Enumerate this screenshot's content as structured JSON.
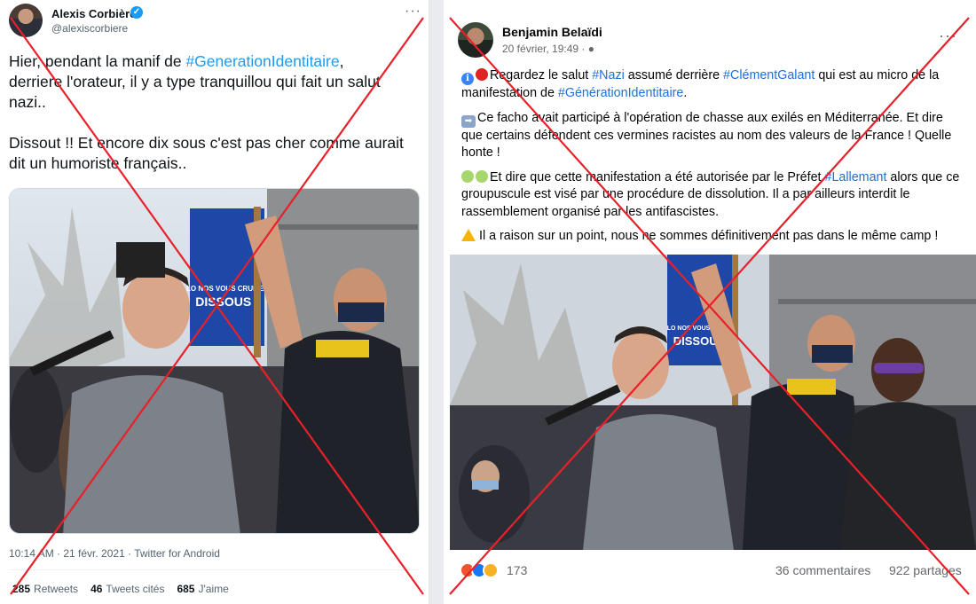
{
  "tweet": {
    "author_name": "Alexis Corbière",
    "handle": "@alexiscorbiere",
    "text_part1": "Hier, pendant la manif de ",
    "hashtag": "#GenerationIdentitaire",
    "text_part2": ",\nderriere l'orateur, il y a type tranquillou qui fait un salut nazi..\n\nDissout !! Et encore dix sous c'est pas cher comme aurait dit un humoriste français..",
    "timestamp": "10:14 AM · 21 févr. 2021 · ",
    "source": "Twitter for Android",
    "stats": {
      "retweets_count": "285",
      "retweets_label": "Retweets",
      "quotes_count": "46",
      "quotes_label": "Tweets cités",
      "likes_count": "685",
      "likes_label": "J'aime"
    },
    "photo_sign_text": "LO NOS VOUS CRUMEZ DISSOUS !"
  },
  "facebook": {
    "author_name": "Benjamin Belaïdi",
    "date": "20 février, 19:49 · ",
    "p1_a": "Regardez le salut ",
    "p1_tag1": "#Nazi",
    "p1_b": " assumé derrière ",
    "p1_tag2": "#ClémentGalant",
    "p1_c": " qui est au micro de la manifestation de ",
    "p1_tag3": "#GénérationIdentitaire",
    "p1_d": ".",
    "p2": "Ce facho avait participé à l'opération de chasse aux exilés en Méditerranée. Et dire que certains défendent ces vermines racistes au nom des valeurs de la France ! Quelle honte !",
    "p3_a": "Et dire que cette manifestation a été autorisée par le Préfet ",
    "p3_tag": "#Lallemant",
    "p3_b": " alors que ce groupuscule est visé par une procédure de dissolution. Il a par ailleurs interdit le rassemblement organisé par les antifascistes.",
    "p4": "Il a raison sur un point, nous ne sommes définitivement pas dans le même camp !",
    "reaction_count": "173",
    "comments": "36 commentaires",
    "shares": "922 partages",
    "photo_sign_text": "LO NOS VOUS CRUMEZ DISSOUS !"
  },
  "icons": {
    "verified": "verified-badge-icon",
    "more": "more-options-icon",
    "globe": "globe-icon"
  },
  "colors": {
    "twitter_link": "#1d9bf0",
    "facebook_link": "#216fdb",
    "cross": "#e8202a"
  }
}
